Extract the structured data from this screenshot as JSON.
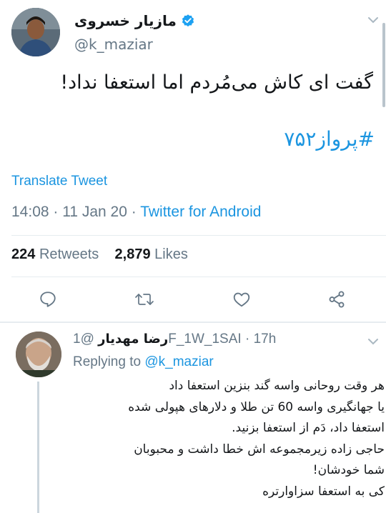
{
  "tweet": {
    "display_name": "مازیار خسروی",
    "handle": "@k_maziar",
    "text": "گفت ای کاش می‌مُردم اما استعفا نداد!",
    "hashtag": "#پرواز۷۵۲",
    "translate_label": "Translate Tweet",
    "time": "14:08",
    "date": "11 Jan 20",
    "source": "Twitter for Android",
    "retweets_count": "224",
    "retweets_label": "Retweets",
    "likes_count": "2,879",
    "likes_label": "Likes"
  },
  "reply": {
    "display_name": "رضا مهدیار",
    "handle": "@1F_1W_1SAI",
    "time": "17h",
    "replying_to_label": "Replying to",
    "replying_to_handle": "@k_maziar",
    "lines": [
      "هر وقت روحانی واسه گند بنزین استعفا داد",
      "یا جهانگیری واسه 60 تن طلا و دلارهای هپولی شده",
      "استعفا داد، دَم از استعفا بزنید.",
      "حاجی زاده زیرمجموعه اش خطا داشت و محبوبان",
      "شما خودشان!",
      "کی به استعفا سزاوارتره"
    ]
  },
  "colors": {
    "link": "#1b95e0",
    "secondary_text": "#657786",
    "primary_text": "#14171a",
    "divider": "#e6ecf0",
    "thread_line": "#ccd6dd"
  },
  "icons": [
    "verified-badge-icon",
    "chevron-down-icon",
    "reply-icon",
    "retweet-icon",
    "like-icon",
    "share-icon"
  ]
}
